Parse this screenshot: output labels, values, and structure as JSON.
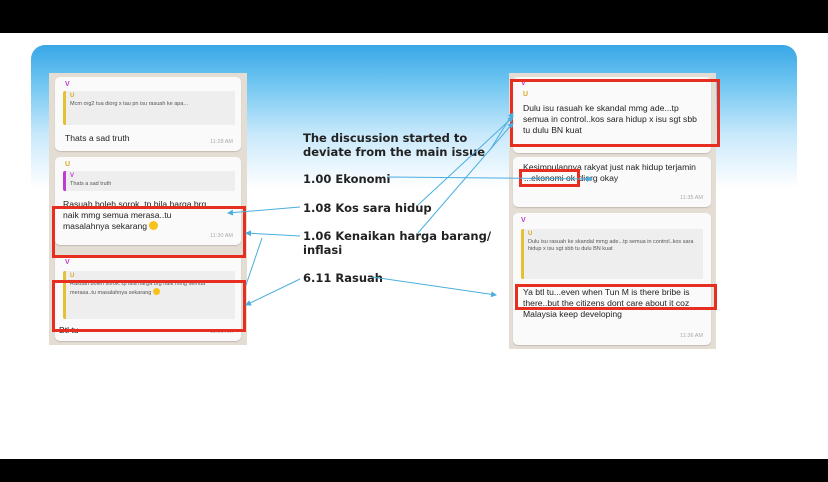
{
  "heading": "The discussion started to deviate from the main issue",
  "codes": [
    {
      "id": "c1",
      "text": "1.00 Ekonomi"
    },
    {
      "id": "c2",
      "text": "1.08 Kos sara hidup"
    },
    {
      "id": "c3",
      "text": "1.06 Kenaikan harga barang/ inflasi"
    },
    {
      "id": "c4",
      "text": "6.11 Rasuah"
    }
  ],
  "left_chat": {
    "m1": {
      "quote_sender": "U",
      "quote_text": "Mcm org2 tua diorg x tau pn isu rasuah ke apa...",
      "text": "Thats a sad truth",
      "time": "11:28 AM",
      "sender": "V"
    },
    "m2": {
      "sender": "U",
      "quote_sender": "V",
      "quote_text": "Thats a sad truth",
      "text": "Rasuah boleh sorok..tp bila harga brg naik mmg semua merasa..tu masalahnya sekarang",
      "time": "11:30 AM"
    },
    "m3": {
      "sender": "V",
      "quote_sender": "U",
      "quote_text": "Rasuah boleh sorok..tp bila harga brg naik mmg semua merasa..tu masalahnya sekarang",
      "text": "Btl tu",
      "time": "11:30 AM"
    }
  },
  "right_chat": {
    "m1": {
      "sender": "V",
      "quote_sender": "U",
      "text": "Dulu isu rasuah ke skandal mmg ade...tp semua in control..kos sara hidup x isu sgt sbb tu dulu BN kuat"
    },
    "m2": {
      "text_before": "Kesimpulannya rakyat just nak hidup terjamin",
      "highlight": "...ekonomi ok",
      "text_after": "diorg okay",
      "time": "11:35 AM"
    },
    "m3": {
      "sender": "V",
      "quote_sender": "U",
      "quote_text": "Dulu isu rasuah ke skandal mmg ade...tp semua in control..kos sara hidup x isu sgt sbb tu dulu BN kuat",
      "text": "Ya btl tu...even when Tun M is there bribe is there..but the citizens dont care about it coz Malaysia keep developing",
      "time": "11:36 AM"
    }
  },
  "colors": {
    "highlight_box": "#e62e21",
    "banner": "#39a7e6",
    "chat_bg": "#e4ddd4",
    "arrow": "#4aaedf",
    "sender_u": "#d4a92a",
    "sender_v": "#c23ad6"
  }
}
